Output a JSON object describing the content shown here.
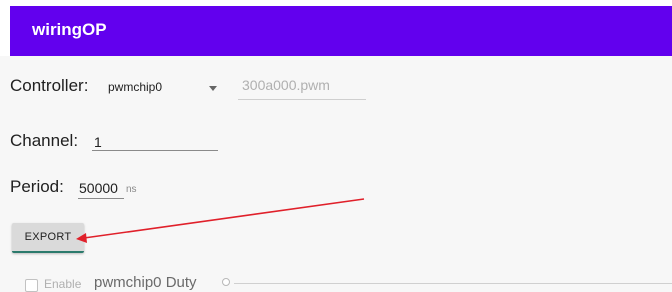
{
  "appbar": {
    "title": "wiringOP",
    "color": "#6200ee"
  },
  "controller": {
    "label": "Controller:",
    "selected": "pwmchip0",
    "address_value": "300a000.pwm"
  },
  "channel": {
    "label": "Channel:",
    "value": "1"
  },
  "period": {
    "label": "Period:",
    "value": "50000",
    "unit": "ns"
  },
  "export_button": {
    "label": "EXPORT"
  },
  "duty_row": {
    "enable_label": "Enable",
    "duty_label": "pwmchip0 Duty",
    "enabled": false
  },
  "annotation": {
    "arrow_color": "#e0202a"
  },
  "icons": {
    "dropdown": "chevron-down-icon",
    "slider_thumb": "slider-thumb"
  }
}
